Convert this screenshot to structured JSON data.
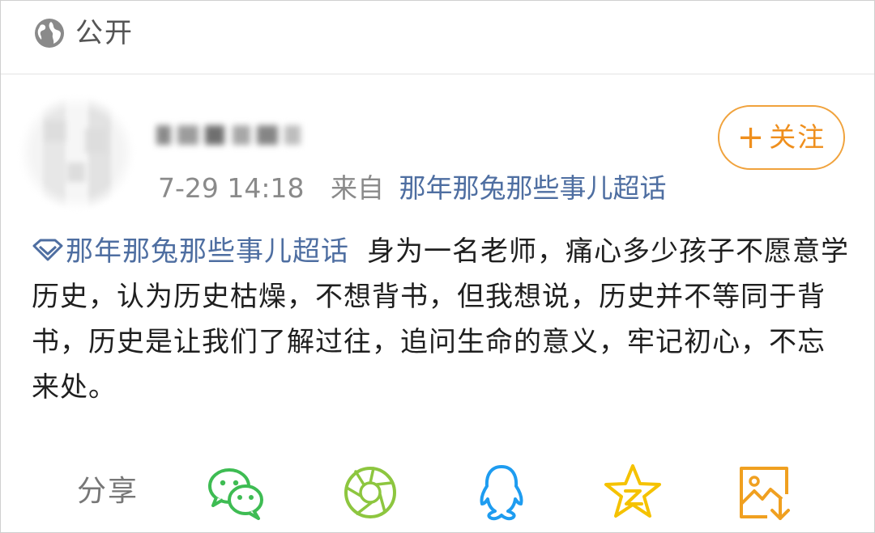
{
  "header": {
    "visibility_icon": "globe-icon",
    "visibility_label": "公开"
  },
  "author": {
    "avatar": "blurred-avatar",
    "time": "7-29 14:18",
    "from_label": "来自",
    "source": "那年那兔那些事儿超话"
  },
  "follow": {
    "plus": "+",
    "label": "关注"
  },
  "post": {
    "topic_icon": "diamond-icon",
    "topic": "那年那兔那些事儿超话",
    "text": "身为一名老师，痛心多少孩子不愿意学历史，认为历史枯燥，不想背书，但我想说，历史并不等同于背书，历史是让我们了解过往，追问生命的意义，牢记初心，不忘来处。"
  },
  "share": {
    "label": "分享",
    "icons": [
      "wechat-icon",
      "moments-icon",
      "qq-icon",
      "qzone-icon",
      "save-image-icon"
    ]
  },
  "colors": {
    "link": "#4e6ea1",
    "accent_orange": "#ef8f1d",
    "wechat_green": "#3ebc53",
    "moments_green": "#8dc63f",
    "qq_blue": "#1e9cf0",
    "qzone_yellow": "#f5c200",
    "save_orange": "#f0a020"
  }
}
